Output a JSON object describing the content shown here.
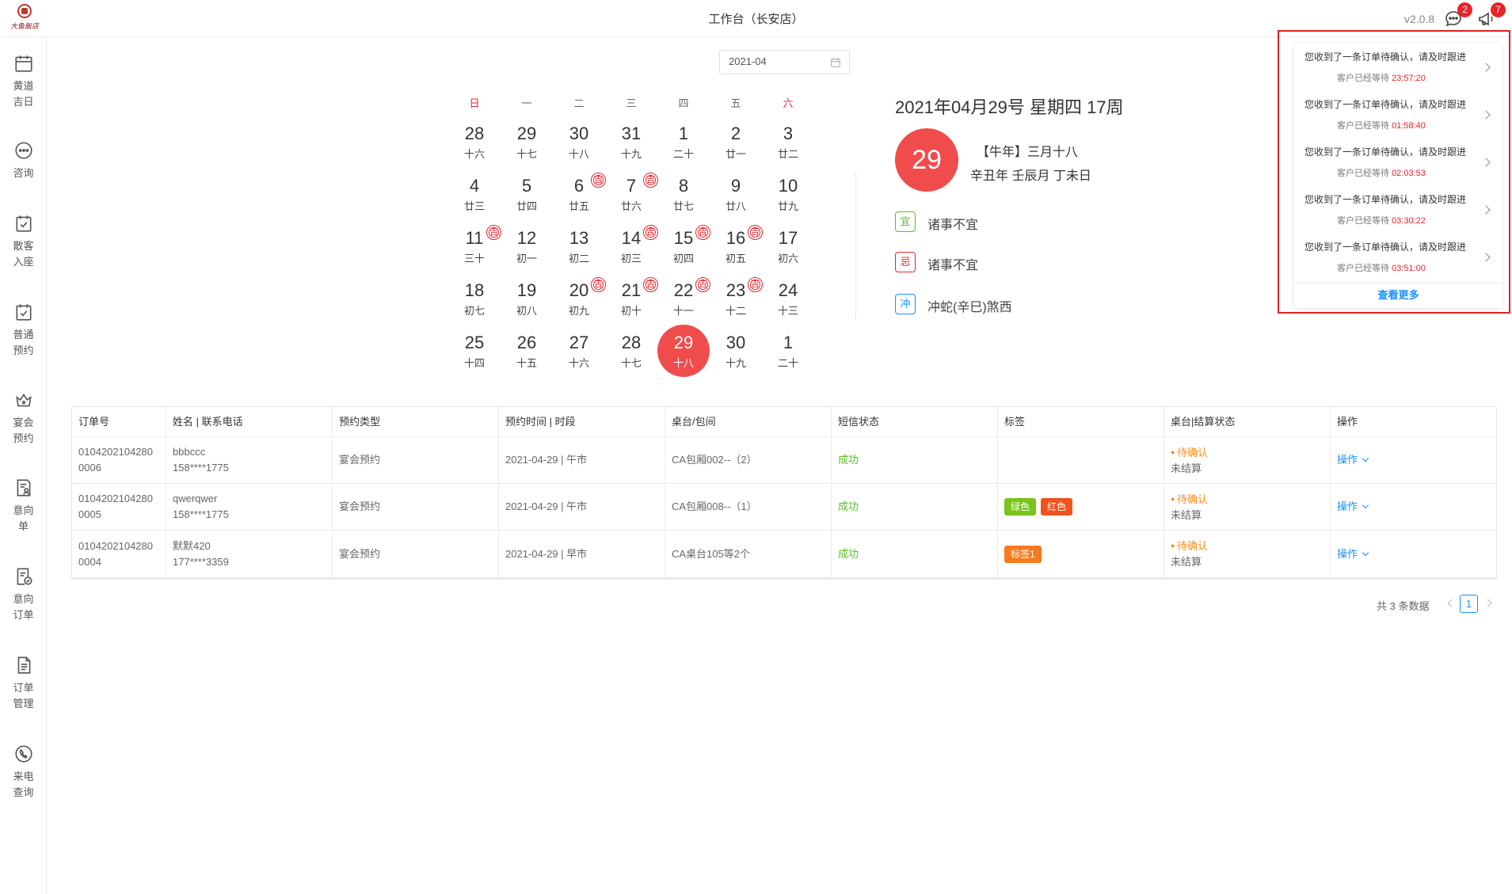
{
  "header": {
    "logo_text": "大鱼飯店",
    "title": "工作台（长安店）",
    "version": "v2.0.8",
    "message_badge": "2",
    "notice_badge": "7"
  },
  "sidebar": {
    "items": [
      {
        "label": "黄道\n吉日",
        "icon": "calendar-icon"
      },
      {
        "label": "咨询",
        "icon": "chat-icon"
      },
      {
        "label": "散客\n入座",
        "icon": "calendar-check-icon"
      },
      {
        "label": "普通\n预约",
        "icon": "calendar-check-icon"
      },
      {
        "label": "宴会\n预约",
        "icon": "crown-icon"
      },
      {
        "label": "意向\n单",
        "icon": "document-person-icon"
      },
      {
        "label": "意向\n订单",
        "icon": "document-check-icon"
      },
      {
        "label": "订单\n管理",
        "icon": "document-icon"
      },
      {
        "label": "来电\n查询",
        "icon": "phone-icon"
      }
    ]
  },
  "datepicker": {
    "value": "2021-04"
  },
  "calendar": {
    "weekdays": [
      "日",
      "一",
      "二",
      "三",
      "四",
      "五",
      "六"
    ],
    "weeks": [
      [
        {
          "d": "28",
          "l": "十六"
        },
        {
          "d": "29",
          "l": "十七"
        },
        {
          "d": "30",
          "l": "十八"
        },
        {
          "d": "31",
          "l": "十九"
        },
        {
          "d": "1",
          "l": "二十"
        },
        {
          "d": "2",
          "l": "廿一"
        },
        {
          "d": "3",
          "l": "廿二"
        }
      ],
      [
        {
          "d": "4",
          "l": "廿三"
        },
        {
          "d": "5",
          "l": "廿四"
        },
        {
          "d": "6",
          "l": "廿五",
          "ji": true
        },
        {
          "d": "7",
          "l": "廿六",
          "ji": true
        },
        {
          "d": "8",
          "l": "廿七"
        },
        {
          "d": "9",
          "l": "廿八"
        },
        {
          "d": "10",
          "l": "廿九"
        }
      ],
      [
        {
          "d": "11",
          "l": "三十",
          "ji": true
        },
        {
          "d": "12",
          "l": "初一"
        },
        {
          "d": "13",
          "l": "初二"
        },
        {
          "d": "14",
          "l": "初三",
          "ji": true
        },
        {
          "d": "15",
          "l": "初四",
          "ji": true
        },
        {
          "d": "16",
          "l": "初五",
          "ji": true
        },
        {
          "d": "17",
          "l": "初六"
        }
      ],
      [
        {
          "d": "18",
          "l": "初七"
        },
        {
          "d": "19",
          "l": "初八"
        },
        {
          "d": "20",
          "l": "初九",
          "ji": true
        },
        {
          "d": "21",
          "l": "初十",
          "ji": true
        },
        {
          "d": "22",
          "l": "十一",
          "ji": true
        },
        {
          "d": "23",
          "l": "十二",
          "ji": true
        },
        {
          "d": "24",
          "l": "十三"
        }
      ],
      [
        {
          "d": "25",
          "l": "十四"
        },
        {
          "d": "26",
          "l": "十五"
        },
        {
          "d": "27",
          "l": "十六"
        },
        {
          "d": "28",
          "l": "十七"
        },
        {
          "d": "29",
          "l": "十八",
          "selected": true
        },
        {
          "d": "30",
          "l": "十九"
        },
        {
          "d": "1",
          "l": "二十"
        }
      ]
    ],
    "ji_label": "吉"
  },
  "detail": {
    "title": "2021年04月29号 星期四 17周",
    "day": "29",
    "lunar_line1": "【牛年】三月十八",
    "lunar_line2": "辛丑年 壬辰月 丁未日",
    "yi_label": "宜",
    "yi_text": "诸事不宜",
    "ji_label": "忌",
    "ji_text": "诸事不宜",
    "chong_label": "冲",
    "chong_text": "冲蛇(辛巳)煞西",
    "colors": {
      "yi": "#52c41a",
      "ji": "#e8232b",
      "chong": "#1890ff"
    }
  },
  "table": {
    "headers": [
      "订单号",
      "姓名 | 联系电话",
      "预约类型",
      "预约时间 | 时段",
      "桌台/包间",
      "短信状态",
      "标签",
      "桌台|结算状态",
      "操作"
    ],
    "rows": [
      {
        "order": [
          "0104202104280",
          "0006"
        ],
        "name": "bbbccc",
        "phone": "158****1775",
        "type": "宴会预约",
        "time": "2021-04-29 | 午市",
        "table": "CA包厢002--（2）",
        "sms": "成功",
        "labels": [],
        "status": "待确认",
        "settle": "未结算",
        "op": "操作"
      },
      {
        "order": [
          "0104202104280",
          "0005"
        ],
        "name": "qwerqwer",
        "phone": "158****1775",
        "type": "宴会预约",
        "time": "2021-04-29 | 午市",
        "table": "CA包厢008--（1）",
        "sms": "成功",
        "labels": [
          {
            "text": "绿色",
            "color": "#7ac41c"
          },
          {
            "text": "红色",
            "color": "#f0541e"
          }
        ],
        "status": "待确认",
        "settle": "未结算",
        "op": "操作"
      },
      {
        "order": [
          "0104202104280",
          "0004"
        ],
        "name": "默默420",
        "phone": "177****3359",
        "type": "宴会预约",
        "time": "2021-04-29 | 早市",
        "table": "CA桌台105等2个",
        "sms": "成功",
        "labels": [
          {
            "text": "标签1",
            "color": "#f77b1e"
          }
        ],
        "status": "待确认",
        "settle": "未结算",
        "op": "操作"
      }
    ]
  },
  "pagination": {
    "total": "共 3 条数据",
    "current": "1"
  },
  "notifications": {
    "items": [
      {
        "title": "您收到了一条订单待确认，请及时跟进",
        "sub": "客户已经等待 ",
        "time": "23:57:20"
      },
      {
        "title": "您收到了一条订单待确认，请及时跟进",
        "sub": "客户已经等待 ",
        "time": "01:58:40"
      },
      {
        "title": "您收到了一条订单待确认，请及时跟进",
        "sub": "客户已经等待 ",
        "time": "02:03:53"
      },
      {
        "title": "您收到了一条订单待确认，请及时跟进",
        "sub": "客户已经等待 ",
        "time": "03:30:22"
      },
      {
        "title": "您收到了一条订单待确认，请及时跟进",
        "sub": "客户已经等待 ",
        "time": "03:51:00"
      }
    ],
    "more": "查看更多"
  }
}
